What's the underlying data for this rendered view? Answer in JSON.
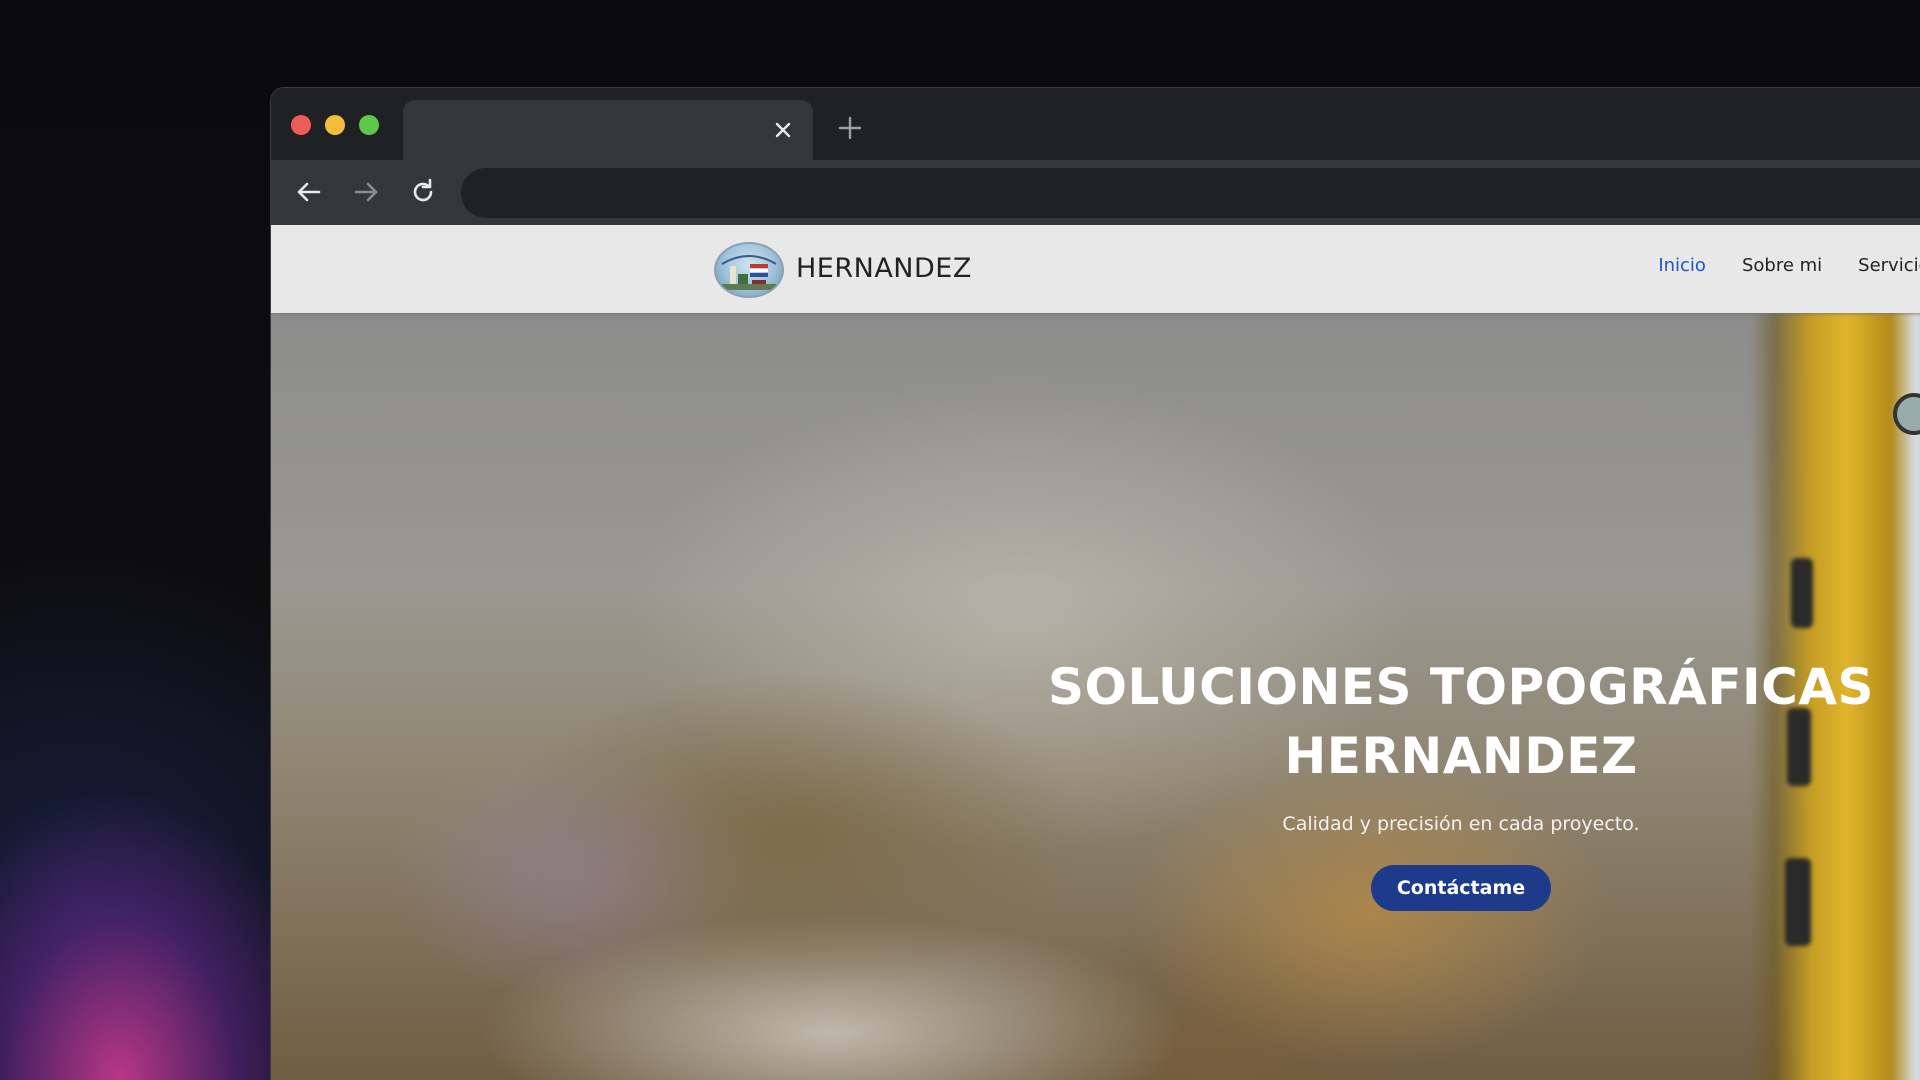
{
  "browser": {
    "tab_title": "",
    "tab_close_icon": "close-icon",
    "new_tab_icon": "plus-icon",
    "address_bar_value": "",
    "controls": {
      "back_icon": "arrow-left-icon",
      "forward_icon": "arrow-right-icon",
      "reload_icon": "reload-icon"
    },
    "traffic_lights": {
      "close_color": "#ee5c56",
      "minimize_color": "#f5bd3c",
      "maximize_color": "#5fc84a"
    }
  },
  "site": {
    "brand": {
      "name": "HERNANDEZ",
      "logo_icon": "company-logo"
    },
    "nav": {
      "items": [
        {
          "label": "Inicio",
          "active": true
        },
        {
          "label": "Sobre mi",
          "active": false
        },
        {
          "label": "Servicios",
          "active": false
        }
      ],
      "active_color": "#1a56c8"
    },
    "hero": {
      "title_line1": "SOLUCIONES TOPOGRÁFICAS",
      "title_line2": "HERNANDEZ",
      "subtitle": "Calidad y precisión en cada proyecto.",
      "cta_label": "Contáctame",
      "cta_color": "#1e3a8a"
    }
  }
}
